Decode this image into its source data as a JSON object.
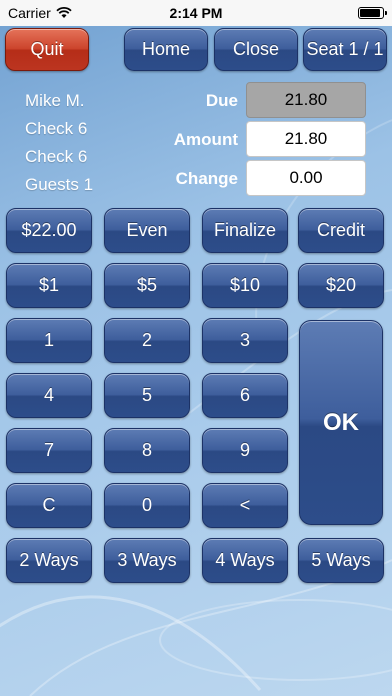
{
  "status": {
    "carrier": "Carrier",
    "time": "2:14 PM"
  },
  "top_buttons": {
    "quit": "Quit",
    "home": "Home",
    "close": "Close",
    "seat": "Seat 1 / 1"
  },
  "info": {
    "server": "Mike M.",
    "check1": "Check 6",
    "check2": "Check 6",
    "guests": "Guests 1"
  },
  "payment": {
    "due_label": "Due",
    "due_value": "21.80",
    "amount_label": "Amount",
    "amount_value": "21.80",
    "change_label": "Change",
    "change_value": "0.00"
  },
  "actions": {
    "preset": "$22.00",
    "even": "Even",
    "finalize": "Finalize",
    "credit": "Credit"
  },
  "quick_cash": [
    "$1",
    "$5",
    "$10",
    "$20"
  ],
  "keypad": {
    "k1": "1",
    "k2": "2",
    "k3": "3",
    "k4": "4",
    "k5": "5",
    "k6": "6",
    "k7": "7",
    "k8": "8",
    "k9": "9",
    "clear": "C",
    "k0": "0",
    "back": "<",
    "ok": "OK"
  },
  "split": [
    "2 Ways",
    "3 Ways",
    "4 Ways",
    "5 Ways"
  ],
  "colors": {
    "button_blue": "#2d4d8a",
    "quit_red": "#cc442c",
    "background": "#9cc2e6"
  }
}
